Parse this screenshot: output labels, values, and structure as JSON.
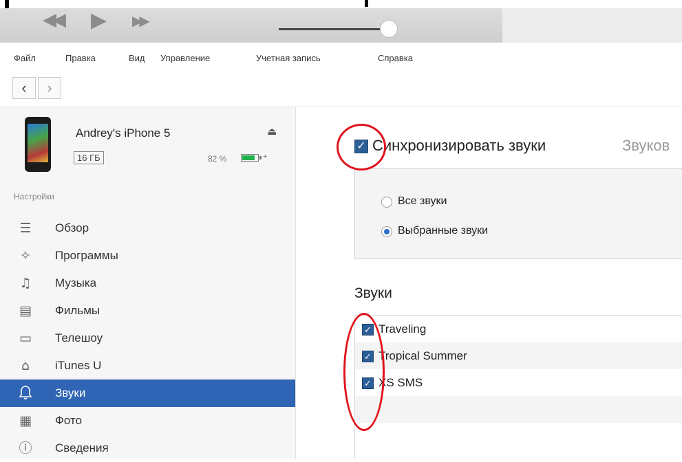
{
  "menu": [
    "Файл",
    "Правка",
    "Вид",
    "Управление",
    "Учетная запись",
    "Справка"
  ],
  "nav": {
    "back": "‹",
    "forward": "›"
  },
  "device": {
    "name": "Andrey's iPhone 5",
    "capacity": "16 ГБ",
    "battery_text": "82 %",
    "battery_level": 0.82,
    "eject_glyph": "⏏",
    "charge_glyph": "+"
  },
  "sidebar": {
    "section_label": "Настройки",
    "items": [
      {
        "label": "Обзор",
        "icon": "☰",
        "icon_name": "summary-icon"
      },
      {
        "label": "Программы",
        "icon": "✧",
        "icon_name": "apps-icon"
      },
      {
        "label": "Музыка",
        "icon": "♫",
        "icon_name": "music-icon"
      },
      {
        "label": "Фильмы",
        "icon": "▤",
        "icon_name": "film-icon"
      },
      {
        "label": "Телешоу",
        "icon": "▭",
        "icon_name": "tv-icon"
      },
      {
        "label": "iTunes U",
        "icon": "⌂",
        "icon_name": "itunes-u-icon"
      },
      {
        "label": "Звуки",
        "icon": "🔔",
        "icon_name": "bell-icon",
        "active": true
      },
      {
        "label": "Фото",
        "icon": "▦",
        "icon_name": "camera-icon"
      },
      {
        "label": "Сведения",
        "icon": "ⓘ",
        "icon_name": "info-icon"
      }
    ]
  },
  "main": {
    "sync_label": "Синхронизировать звуки",
    "sync_suffix": "Звуков",
    "radio_all": "Все звуки",
    "radio_selected": "Выбранные звуки",
    "sounds_title": "Звуки",
    "sounds": [
      "Traveling",
      "Tropical Summer",
      "XS SMS"
    ]
  },
  "colors": {
    "accent": "#2f65b4",
    "annotation": "#e0141e",
    "battery": "#22b14c"
  }
}
